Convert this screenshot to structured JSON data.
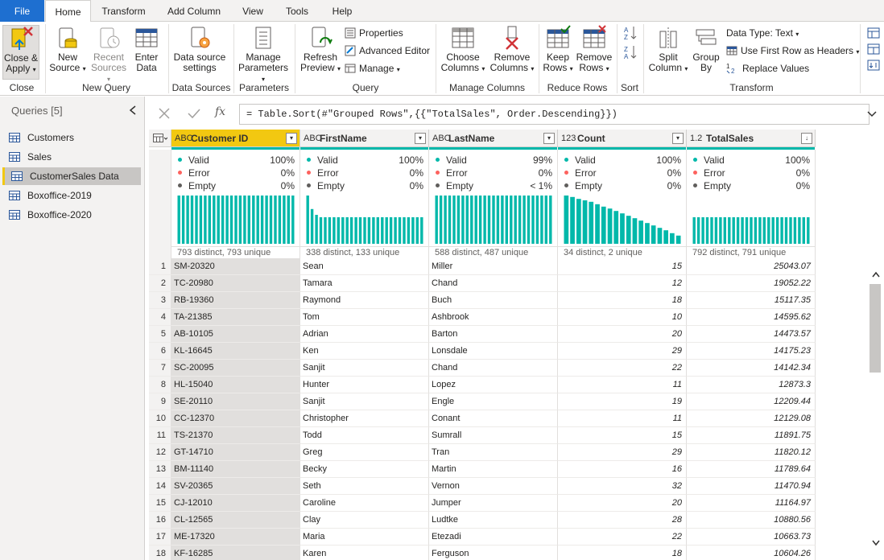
{
  "tabs": {
    "file": "File",
    "home": "Home",
    "transform": "Transform",
    "add_column": "Add Column",
    "view": "View",
    "tools": "Tools",
    "help": "Help"
  },
  "ribbon": {
    "close_apply": {
      "l1": "Close &",
      "l2": "Apply"
    },
    "new_source": {
      "l1": "New",
      "l2": "Source"
    },
    "recent_sources": {
      "l1": "Recent",
      "l2": "Sources"
    },
    "enter_data": {
      "l1": "Enter",
      "l2": "Data"
    },
    "data_source_settings": {
      "l1": "Data source",
      "l2": "settings"
    },
    "manage_parameters": {
      "l1": "Manage",
      "l2": "Parameters"
    },
    "refresh_preview": {
      "l1": "Refresh",
      "l2": "Preview"
    },
    "properties": "Properties",
    "advanced_editor": "Advanced Editor",
    "manage": "Manage",
    "choose_columns": {
      "l1": "Choose",
      "l2": "Columns"
    },
    "remove_columns": {
      "l1": "Remove",
      "l2": "Columns"
    },
    "keep_rows": {
      "l1": "Keep",
      "l2": "Rows"
    },
    "remove_rows": {
      "l1": "Remove",
      "l2": "Rows"
    },
    "split_column": {
      "l1": "Split",
      "l2": "Column"
    },
    "group_by": {
      "l1": "Group",
      "l2": "By"
    },
    "data_type": "Data Type: Text",
    "first_row_headers": "Use First Row as Headers",
    "replace_values": "Replace Values",
    "groups": {
      "close": "Close",
      "new_query": "New Query",
      "data_sources": "Data Sources",
      "parameters": "Parameters",
      "query": "Query",
      "manage_columns": "Manage Columns",
      "reduce_rows": "Reduce Rows",
      "sort": "Sort",
      "transform": "Transform"
    }
  },
  "queries": {
    "header": "Queries [5]",
    "items": [
      "Customers",
      "Sales",
      "CustomerSales Data",
      "Boxoffice-2019",
      "Boxoffice-2020"
    ]
  },
  "formula": "= Table.Sort(#\"Grouped Rows\",{{\"TotalSales\", Order.Descending}})",
  "profile_labels": {
    "valid": "Valid",
    "error": "Error",
    "empty": "Empty"
  },
  "colors": {
    "valid": "#01b8aa",
    "error": "#fd625e",
    "empty": "#605e5c",
    "selected_header": "#f2c811",
    "file_tab": "#1e6fd0"
  },
  "columns": [
    {
      "name": "Customer ID",
      "type": "ABC",
      "valid": "100%",
      "error": "0%",
      "empty": "0%",
      "distinct": "793 distinct, 793 unique",
      "hist": [
        1,
        1,
        1,
        1,
        1,
        1,
        1,
        1,
        1,
        1,
        1,
        1,
        1,
        1,
        1,
        1,
        1,
        1,
        1,
        1,
        1,
        1,
        1,
        1,
        1,
        1,
        1
      ]
    },
    {
      "name": "FirstName",
      "type": "ABC",
      "valid": "100%",
      "error": "0%",
      "empty": "0%",
      "distinct": "338 distinct, 133 unique",
      "hist": [
        1,
        0.72,
        0.6,
        0.55,
        0.55,
        0.55,
        0.55,
        0.55,
        0.55,
        0.55,
        0.55,
        0.55,
        0.55,
        0.55,
        0.55,
        0.55,
        0.55,
        0.55,
        0.55,
        0.55,
        0.55,
        0.55,
        0.55,
        0.55,
        0.55,
        0.55,
        0.55
      ]
    },
    {
      "name": "LastName",
      "type": "ABC",
      "valid": "99%",
      "error": "0%",
      "empty": "< 1%",
      "distinct": "588 distinct, 487 unique",
      "hist": [
        1,
        1,
        1,
        1,
        1,
        1,
        1,
        1,
        1,
        1,
        1,
        1,
        1,
        1,
        1,
        1,
        1,
        1,
        1,
        1,
        1,
        1,
        1,
        1,
        1,
        1,
        1
      ]
    },
    {
      "name": "Count",
      "type": "123",
      "valid": "100%",
      "error": "0%",
      "empty": "0%",
      "distinct": "34 distinct, 2 unique",
      "hist": [
        1,
        0.97,
        0.93,
        0.9,
        0.87,
        0.82,
        0.77,
        0.73,
        0.68,
        0.63,
        0.58,
        0.53,
        0.48,
        0.43,
        0.38,
        0.33,
        0.28,
        0.22,
        0.17
      ]
    },
    {
      "name": "TotalSales",
      "type": "1.2",
      "valid": "100%",
      "error": "0%",
      "empty": "0%",
      "distinct": "792 distinct, 791 unique",
      "hist": [
        0.55,
        0.55,
        0.55,
        0.55,
        0.55,
        0.55,
        0.55,
        0.55,
        0.55,
        0.55,
        0.55,
        0.55,
        0.55,
        0.55,
        0.55,
        0.55,
        0.55,
        0.55,
        0.55,
        0.55,
        0.55,
        0.55,
        0.55,
        0.55,
        0.55,
        0.55,
        0.55
      ]
    }
  ],
  "rows": [
    [
      "1",
      "SM-20320",
      "Sean",
      "Miller",
      "15",
      "25043.07"
    ],
    [
      "2",
      "TC-20980",
      "Tamara",
      "Chand",
      "12",
      "19052.22"
    ],
    [
      "3",
      "RB-19360",
      "Raymond",
      "Buch",
      "18",
      "15117.35"
    ],
    [
      "4",
      "TA-21385",
      "Tom",
      "Ashbrook",
      "10",
      "14595.62"
    ],
    [
      "5",
      "AB-10105",
      "Adrian",
      "Barton",
      "20",
      "14473.57"
    ],
    [
      "6",
      "KL-16645",
      "Ken",
      "Lonsdale",
      "29",
      "14175.23"
    ],
    [
      "7",
      "SC-20095",
      "Sanjit",
      "Chand",
      "22",
      "14142.34"
    ],
    [
      "8",
      "HL-15040",
      "Hunter",
      "Lopez",
      "11",
      "12873.3"
    ],
    [
      "9",
      "SE-20110",
      "Sanjit",
      "Engle",
      "19",
      "12209.44"
    ],
    [
      "10",
      "CC-12370",
      "Christopher",
      "Conant",
      "11",
      "12129.08"
    ],
    [
      "11",
      "TS-21370",
      "Todd",
      "Sumrall",
      "15",
      "11891.75"
    ],
    [
      "12",
      "GT-14710",
      "Greg",
      "Tran",
      "29",
      "11820.12"
    ],
    [
      "13",
      "BM-11140",
      "Becky",
      "Martin",
      "16",
      "11789.64"
    ],
    [
      "14",
      "SV-20365",
      "Seth",
      "Vernon",
      "32",
      "11470.94"
    ],
    [
      "15",
      "CJ-12010",
      "Caroline",
      "Jumper",
      "20",
      "11164.97"
    ],
    [
      "16",
      "CL-12565",
      "Clay",
      "Ludtke",
      "28",
      "10880.56"
    ],
    [
      "17",
      "ME-17320",
      "Maria",
      "Etezadi",
      "22",
      "10663.73"
    ],
    [
      "18",
      "KF-16285",
      "Karen",
      "Ferguson",
      "18",
      "10604.26"
    ]
  ]
}
